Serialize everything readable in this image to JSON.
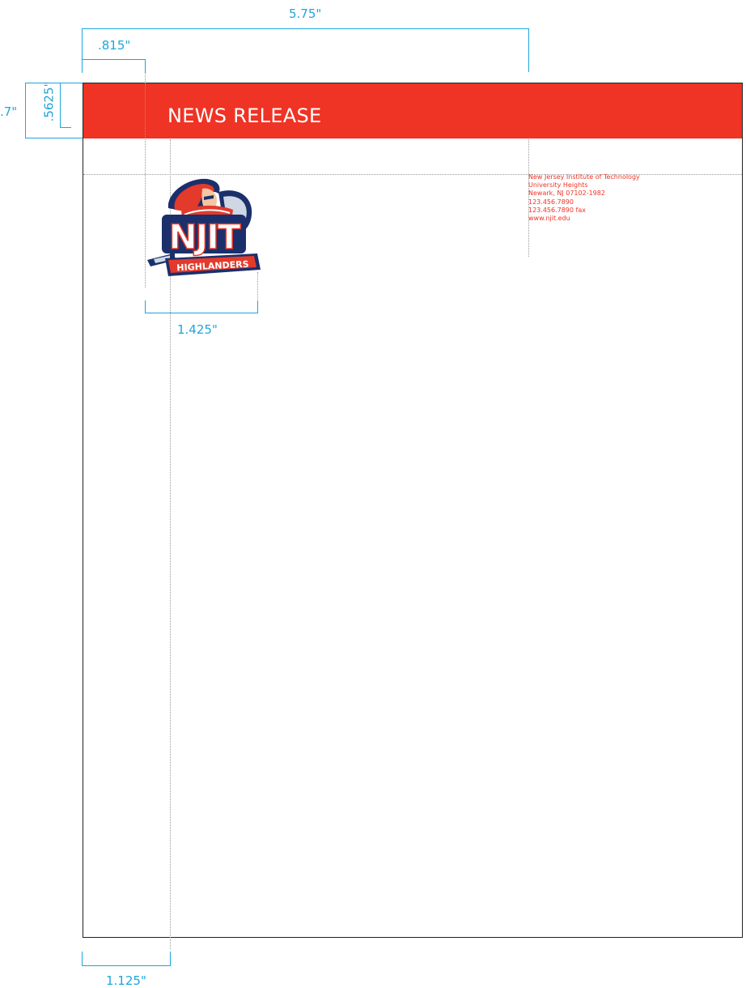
{
  "header": {
    "title": "NEWS RELEASE"
  },
  "address": {
    "lines": [
      "New Jersey Institute of Technology",
      "University Heights",
      "Newark, NJ 07102-1982",
      "123.456.7890",
      "123.456.7890 fax",
      "www.njit.edu"
    ]
  },
  "logo": {
    "wordmark": "NJIT",
    "banner_text": "HIGHLANDERS"
  },
  "dimensions": {
    "width_total": "5.75\"",
    "left_logo_offset": ".815\"",
    "banner_height_outer": ".7\"",
    "banner_height_inner": ".5625\"",
    "logo_width": "1.425\"",
    "left_margin": "1.125\""
  },
  "colors": {
    "brand_red": "#ef3324",
    "dimension_blue": "#1ea6db",
    "logo_navy": "#1b2f6b",
    "white": "#ffffff"
  }
}
